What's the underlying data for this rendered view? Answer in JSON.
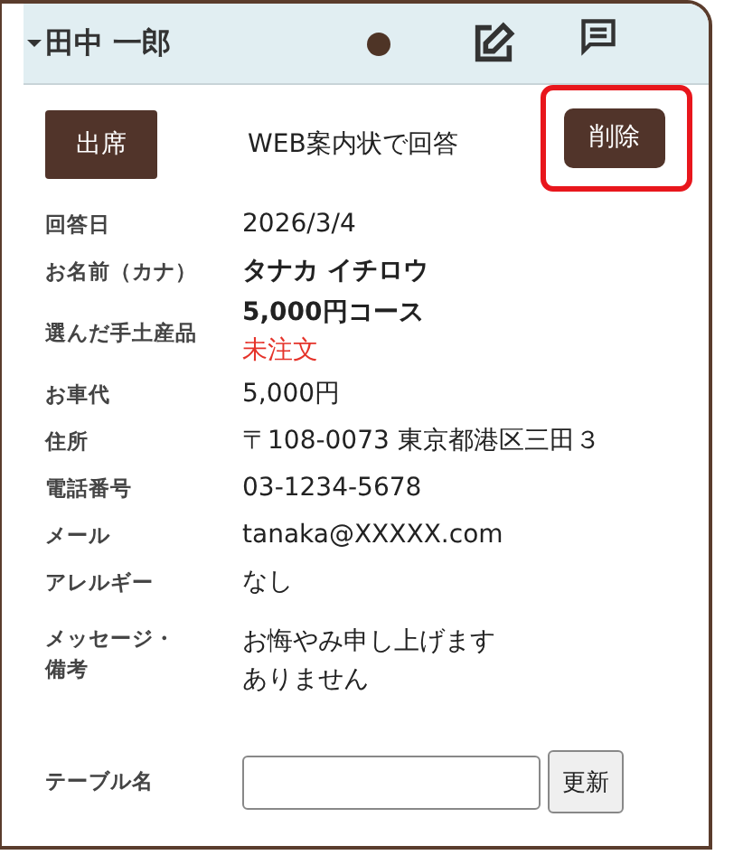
{
  "header": {
    "name": "田中 一郎",
    "expanded": true
  },
  "actions": {
    "attendance": "出席",
    "response_method": "WEB案内状で回答",
    "delete": {
      "label": "削除",
      "highlighted": true
    }
  },
  "fields": [
    {
      "label": "回答日",
      "kind": "text",
      "value": "2026/3/4"
    },
    {
      "label": "お名前（カナ）",
      "kind": "bold",
      "value": "タナカ イチロウ"
    },
    {
      "label": "選んだ手土産品",
      "kind": "gift",
      "value": "5,000円コース",
      "status": "未注文"
    },
    {
      "label": "お車代",
      "kind": "text",
      "value": "5,000円"
    },
    {
      "label": "住所",
      "kind": "text",
      "value": "〒108-0073 東京都港区三田３"
    },
    {
      "label": "電話番号",
      "kind": "text",
      "value": "03-1234-5678"
    },
    {
      "label": "メール",
      "kind": "text",
      "value": "tanaka@XXXXX.com"
    },
    {
      "label": "アレルギー",
      "kind": "text",
      "value": "なし"
    },
    {
      "label": "メッセージ・備考",
      "kind": "multiline",
      "lines": [
        "お悔やみ申し上げます",
        "ありません"
      ]
    }
  ],
  "table_name": {
    "label": "テーブル名",
    "button": "更新"
  }
}
